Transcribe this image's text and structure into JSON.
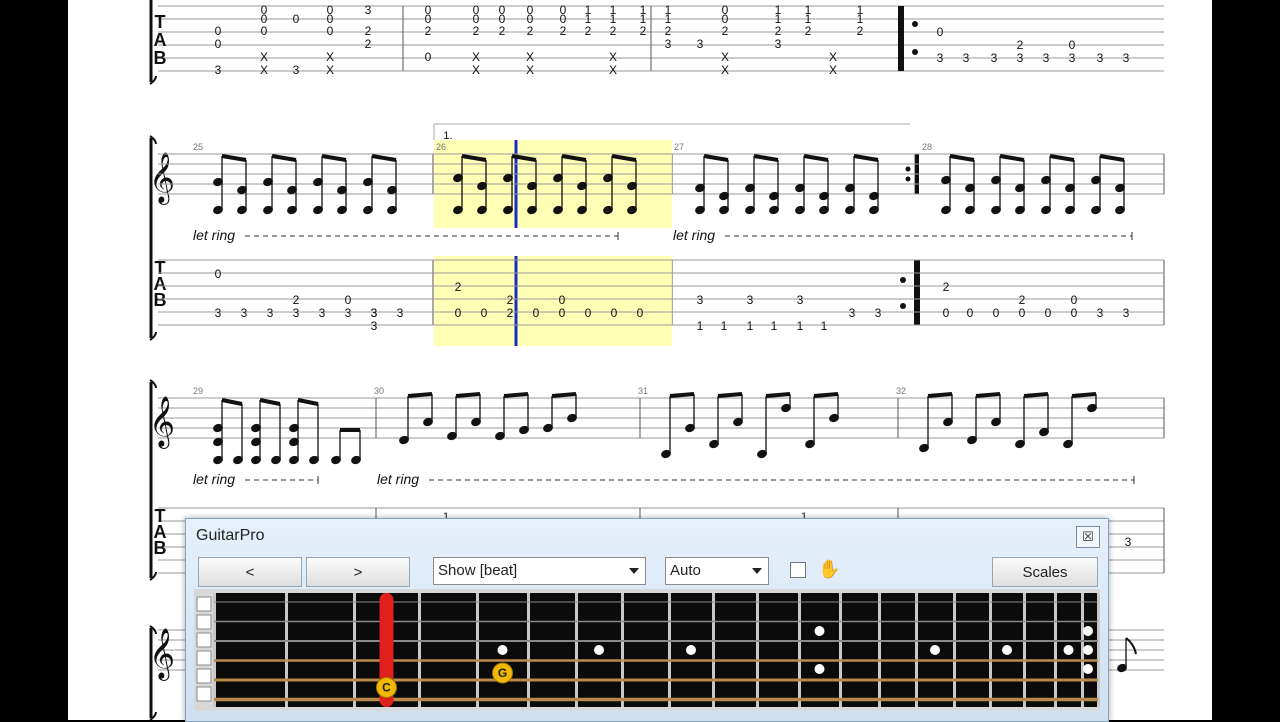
{
  "score": {
    "measures": [
      "25",
      "26",
      "27",
      "28",
      "29",
      "30",
      "31",
      "32"
    ],
    "volta": "1.",
    "let_ring": "let ring",
    "tab_letters": [
      "T",
      "A",
      "B"
    ],
    "tab_top": [
      [
        [
          0,
          "0"
        ],
        [
          1,
          "0"
        ],
        [
          2,
          "0"
        ],
        [
          1,
          "3"
        ],
        [
          2,
          "0"
        ],
        [
          3,
          "0"
        ],
        [
          5,
          "3"
        ]
      ],
      [
        [
          0,
          "3"
        ],
        [
          1,
          "0"
        ],
        [
          2,
          "0"
        ]
      ],
      [
        [
          0,
          "0"
        ],
        [
          1,
          "0"
        ],
        [
          2,
          "0"
        ],
        [
          3,
          "2"
        ],
        [
          4,
          "2"
        ]
      ],
      [
        [
          0,
          "0"
        ],
        [
          1,
          "0"
        ],
        [
          2,
          "0"
        ]
      ],
      [
        [
          3,
          "2"
        ],
        [
          4,
          "2"
        ]
      ],
      [
        [
          3,
          "0"
        ],
        [
          4,
          "X"
        ],
        [
          5,
          "X"
        ]
      ],
      [
        [
          0,
          "3"
        ],
        [
          1,
          "X"
        ],
        [
          2,
          "X"
        ]
      ]
    ],
    "tab_m26_cells": [
      "2",
      "0",
      "0",
      "2",
      "0",
      "0",
      "0",
      "0",
      "0",
      "3",
      "3"
    ],
    "tab_m28_cells": [
      "2",
      "0",
      "0",
      "0",
      "2",
      "0",
      "0",
      "0",
      "0",
      "3",
      "3"
    ],
    "tab_m25_cells": [
      "0",
      "3",
      "3",
      "3",
      "2",
      "3",
      "3",
      "0",
      "3",
      "3",
      "3",
      "3"
    ],
    "tab_m27_cells": [
      "3",
      "3",
      "3",
      "1",
      "1",
      "1",
      "1",
      "1",
      "1",
      "3",
      "3"
    ],
    "tab_row3_cells": [
      "1",
      "3"
    ]
  },
  "guitarpro_window": {
    "title": "GuitarPro",
    "close_icon": "close-icon",
    "prev_label": "<",
    "next_label": ">",
    "show_select": "Show [beat]",
    "auto_select": "Auto",
    "scales_label": "Scales",
    "hand_icon": "hand-icon",
    "fret_markers": [
      {
        "label": "C",
        "fret": 3,
        "string": 5
      },
      {
        "label": "G",
        "fret": 5,
        "string": 4
      }
    ],
    "capo_fret": 3,
    "colors": {
      "marker": "#f0b800",
      "capo": "#e0201c",
      "highlight": "#ffffa8",
      "cursor": "#1a2cc8"
    }
  }
}
